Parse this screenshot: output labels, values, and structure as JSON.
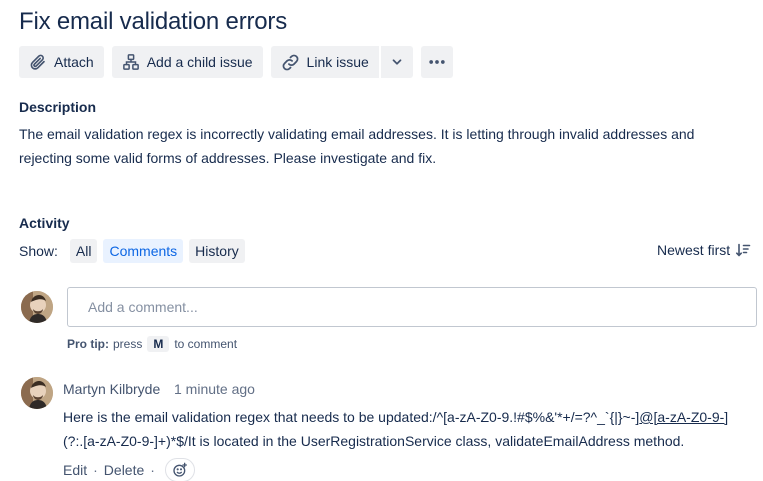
{
  "issue": {
    "title": "Fix email validation errors"
  },
  "toolbar": {
    "attach_label": "Attach",
    "child_issue_label": "Add a child issue",
    "link_issue_label": "Link issue"
  },
  "description": {
    "heading": "Description",
    "text": "The email validation regex is incorrectly validating email addresses. It is letting through invalid addresses and rejecting some valid forms of addresses. Please investigate and fix."
  },
  "activity": {
    "heading": "Activity",
    "show_label": "Show:",
    "filters": [
      {
        "label": "All",
        "active": false
      },
      {
        "label": "Comments",
        "active": true
      },
      {
        "label": "History",
        "active": false
      }
    ],
    "sort_label": "Newest first"
  },
  "comment_input": {
    "placeholder": "Add a comment...",
    "protip_label": "Pro tip:",
    "protip_pre": "press",
    "protip_key": "M",
    "protip_post": "to comment"
  },
  "comment": {
    "author": "Martyn Kilbryde",
    "time": "1 minute ago",
    "line1_text": "Here is the email validation regex that needs to be updated:/^[a-zA-Z0-9.!#$%&'*+/=?^_`{|}~-]",
    "line1_link": "@[a-zA-Z0-9-]",
    "line2_text": "(?:.[a-zA-Z0-9-]+)*$/It is located in the UserRegistrationService class, validateEmailAddress method.",
    "edit_label": "Edit",
    "delete_label": "Delete",
    "separator": "·"
  },
  "colors": {
    "accent": "#0c66e4",
    "button_bg": "#f0f1f3",
    "text": "#172b4d",
    "subtle_text": "#44546f"
  },
  "icons": [
    "paperclip-icon",
    "hierarchy-icon",
    "link-icon",
    "chevron-down-icon",
    "more-icon",
    "sort-icon",
    "emoji-add-icon"
  ]
}
